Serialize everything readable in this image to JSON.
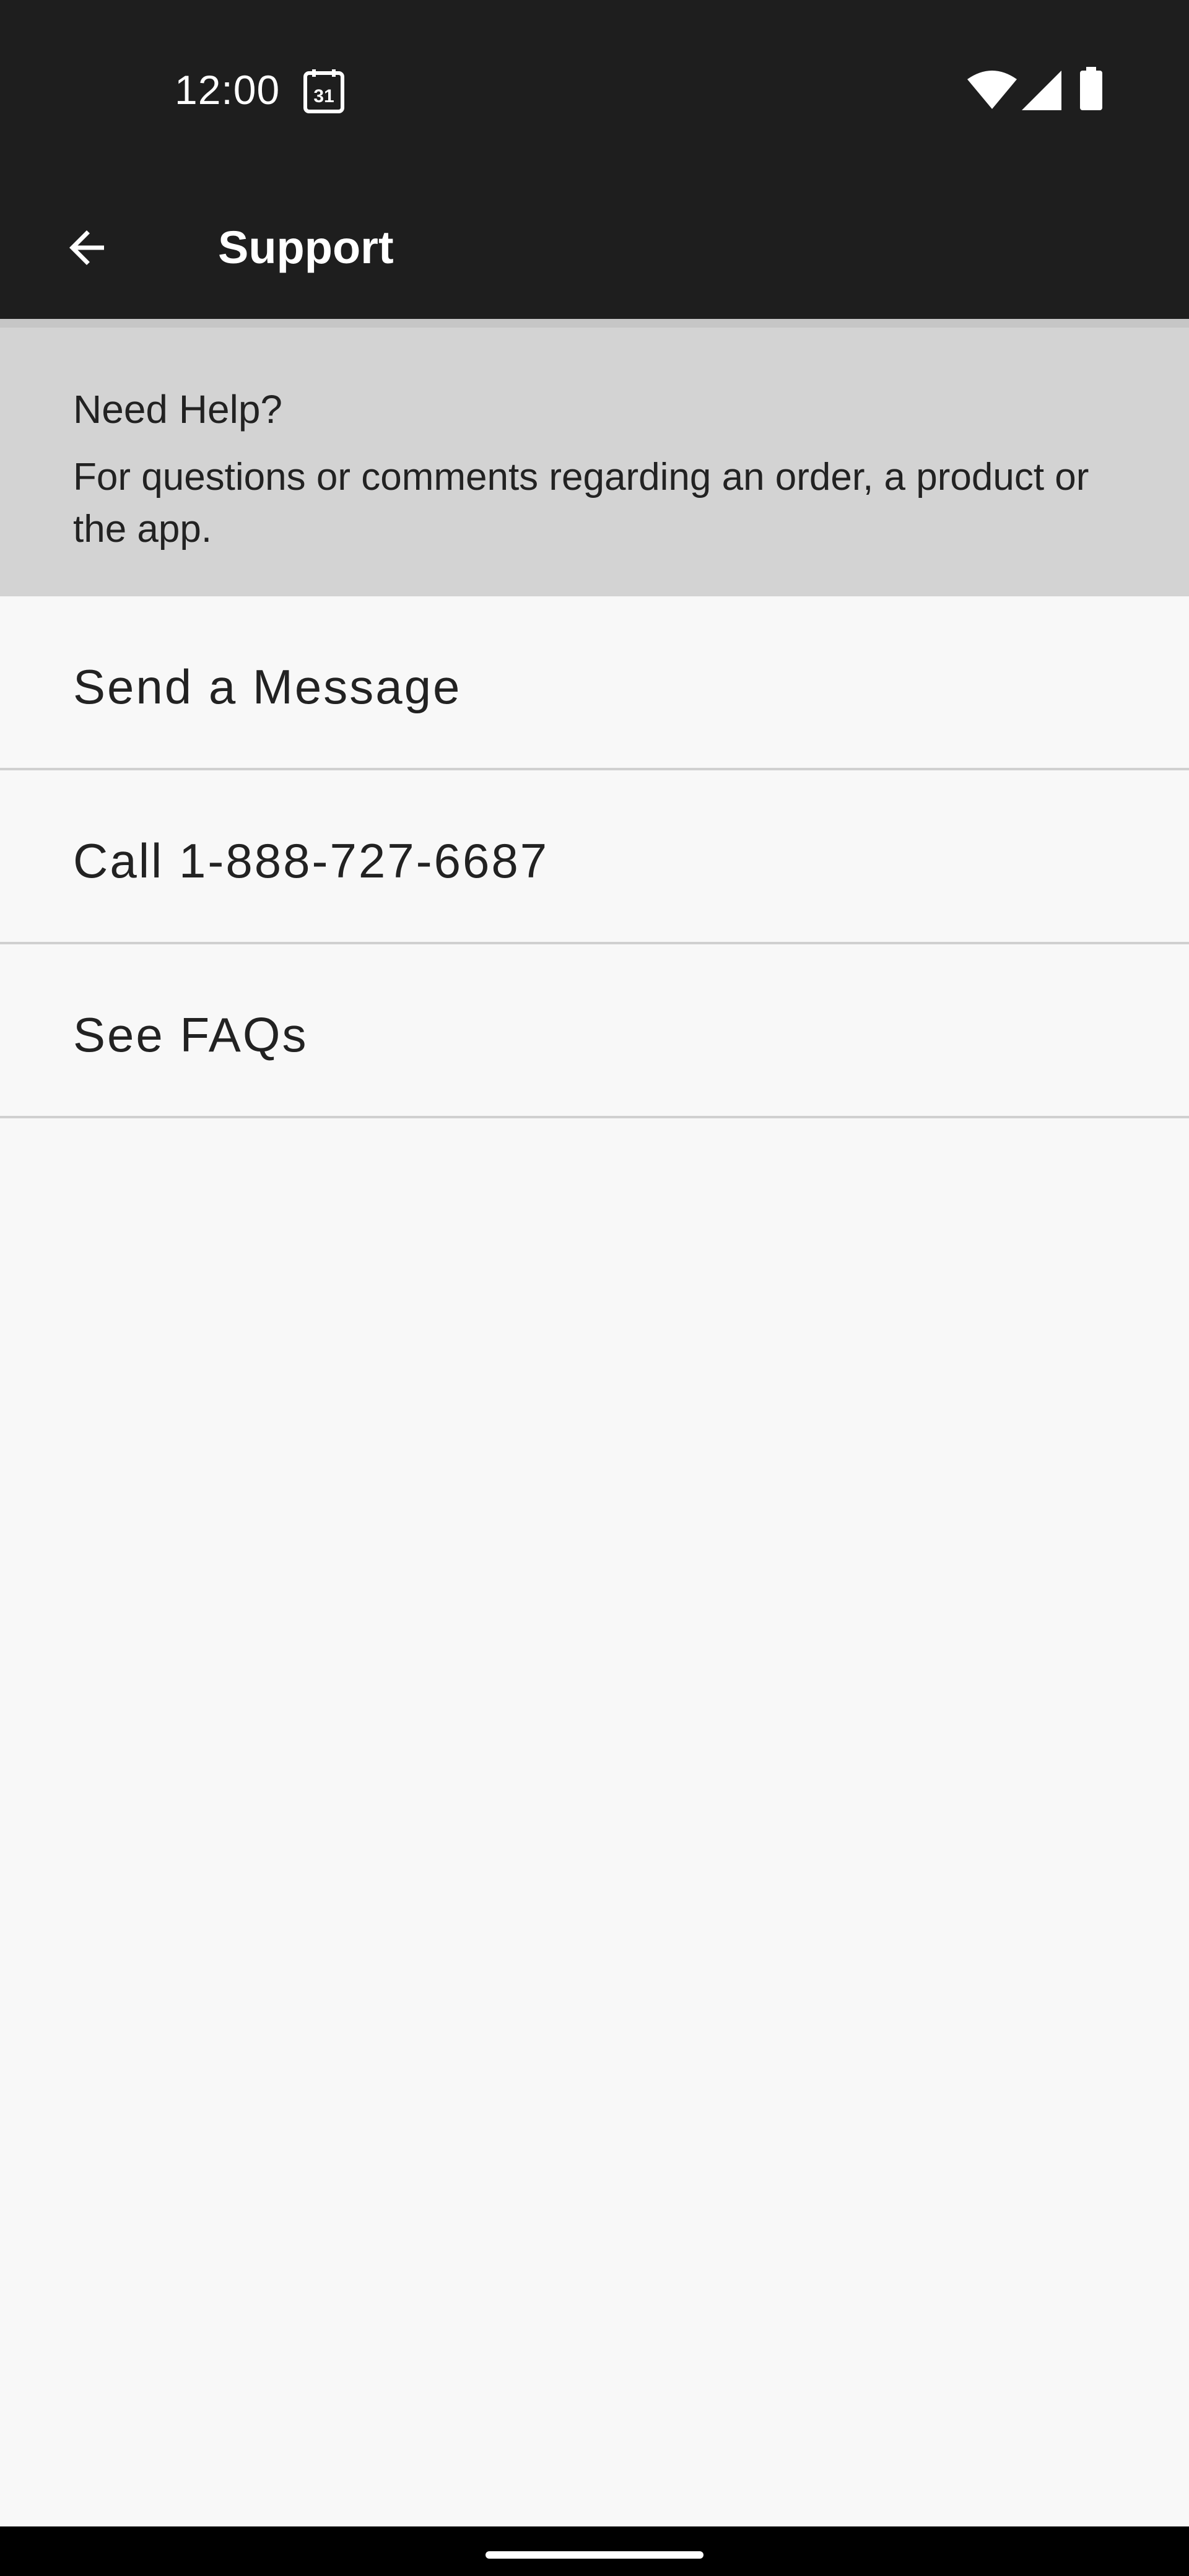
{
  "status_bar": {
    "time": "12:00",
    "calendar_day": "31",
    "icons": [
      "calendar-icon",
      "wifi-icon",
      "signal-icon",
      "battery-icon"
    ]
  },
  "app_bar": {
    "title": "Support",
    "back_icon": "arrow-back-icon"
  },
  "help_banner": {
    "title": "Need Help?",
    "description": "For questions or comments regarding an order, a product or the app."
  },
  "support_options": [
    {
      "label": "Send a Message"
    },
    {
      "label": "Call 1-888-727-6687"
    },
    {
      "label": "See FAQs"
    }
  ],
  "colors": {
    "top_bar": "#1e1e1e",
    "banner": "#d3d3d3",
    "background": "#f8f8f8",
    "divider": "#d0d0d0",
    "nav_bar": "#000000"
  }
}
